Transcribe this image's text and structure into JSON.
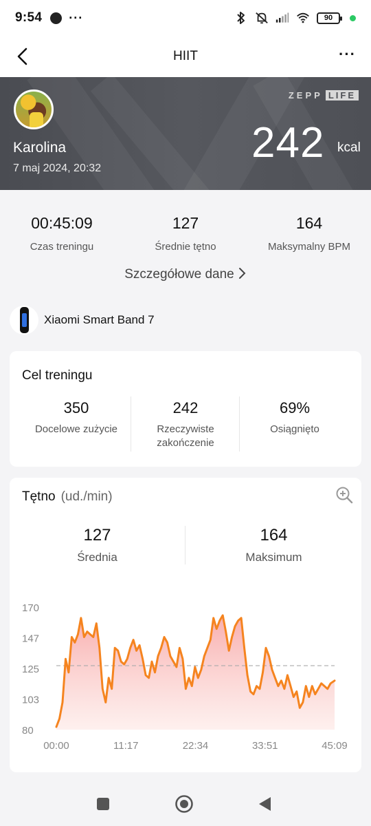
{
  "status_bar": {
    "time": "9:54",
    "more": "···",
    "battery": "90",
    "icons": [
      "bluetooth-icon",
      "mute-icon",
      "signal-icon",
      "wifi-icon",
      "battery-icon"
    ]
  },
  "header": {
    "title": "HIIT",
    "menu": "···"
  },
  "hero": {
    "brand_left": "ZEPP",
    "brand_right": "LIFE",
    "user_name": "Karolina",
    "date": "7 maj 2024, 20:32",
    "kcal_value": "242",
    "kcal_unit": "kcal"
  },
  "stats": [
    {
      "value": "00:45:09",
      "label": "Czas treningu"
    },
    {
      "value": "127",
      "label": "Średnie tętno"
    },
    {
      "value": "164",
      "label": "Maksymalny BPM"
    }
  ],
  "details_link": "Szczegółowe dane",
  "device": {
    "name": "Xiaomi Smart Band 7"
  },
  "goal": {
    "title": "Cel treningu",
    "items": [
      {
        "value": "350",
        "label": "Docelowe zużycie"
      },
      {
        "value": "242",
        "label": "Rzeczywiste zakończenie"
      },
      {
        "value": "69%",
        "label": "Osiągnięto"
      }
    ]
  },
  "heart_rate": {
    "title": "Tętno",
    "unit": "(ud./min)",
    "avg_value": "127",
    "avg_label": "Średnia",
    "max_value": "164",
    "max_label": "Maksimum"
  },
  "chart_data": {
    "type": "area",
    "title": "",
    "xlabel": "",
    "ylabel": "",
    "ylim": [
      80,
      170
    ],
    "y_ticks": [
      "170",
      "147",
      "125",
      "103",
      "80"
    ],
    "x_ticks": [
      "00:00",
      "11:17",
      "22:34",
      "33:51",
      "45:09"
    ],
    "reference_line": 127,
    "line_color": "#f5841f",
    "x": [
      0,
      0.5,
      1,
      1.5,
      2,
      2.5,
      3,
      3.5,
      4,
      4.5,
      5,
      5.5,
      6,
      6.5,
      7,
      7.5,
      8,
      8.5,
      9,
      9.5,
      10,
      10.5,
      11,
      11.5,
      12,
      12.5,
      13,
      13.5,
      14,
      14.5,
      15,
      15.5,
      16,
      16.5,
      17,
      17.5,
      18,
      18.5,
      19,
      19.5,
      20,
      20.5,
      21,
      21.5,
      22,
      22.5,
      23,
      23.5,
      24,
      24.5,
      25,
      25.5,
      26,
      26.5,
      27,
      27.5,
      28,
      28.5,
      29,
      29.5,
      30,
      30.5,
      31,
      31.5,
      32,
      32.5,
      33,
      33.5,
      34,
      34.5,
      35,
      35.5,
      36,
      36.5,
      37,
      37.5,
      38,
      38.5,
      39,
      39.5,
      40,
      40.5,
      41,
      41.5,
      42,
      42.5,
      43,
      43.5,
      44,
      44.5,
      45.15
    ],
    "y": [
      82,
      88,
      100,
      132,
      122,
      148,
      144,
      150,
      162,
      148,
      152,
      150,
      148,
      158,
      140,
      110,
      100,
      118,
      110,
      140,
      138,
      130,
      128,
      132,
      140,
      146,
      138,
      142,
      132,
      120,
      118,
      130,
      122,
      134,
      140,
      148,
      144,
      134,
      130,
      126,
      140,
      132,
      110,
      118,
      112,
      126,
      118,
      124,
      134,
      140,
      146,
      162,
      154,
      160,
      164,
      152,
      138,
      148,
      156,
      160,
      162,
      140,
      120,
      108,
      106,
      112,
      110,
      122,
      140,
      134,
      124,
      118,
      112,
      116,
      110,
      120,
      112,
      104,
      108,
      96,
      100,
      112,
      104,
      112,
      106,
      110,
      114,
      112,
      110,
      114,
      116
    ]
  },
  "nav": {
    "icons": [
      "square-icon",
      "circle-icon",
      "triangle-icon"
    ]
  }
}
